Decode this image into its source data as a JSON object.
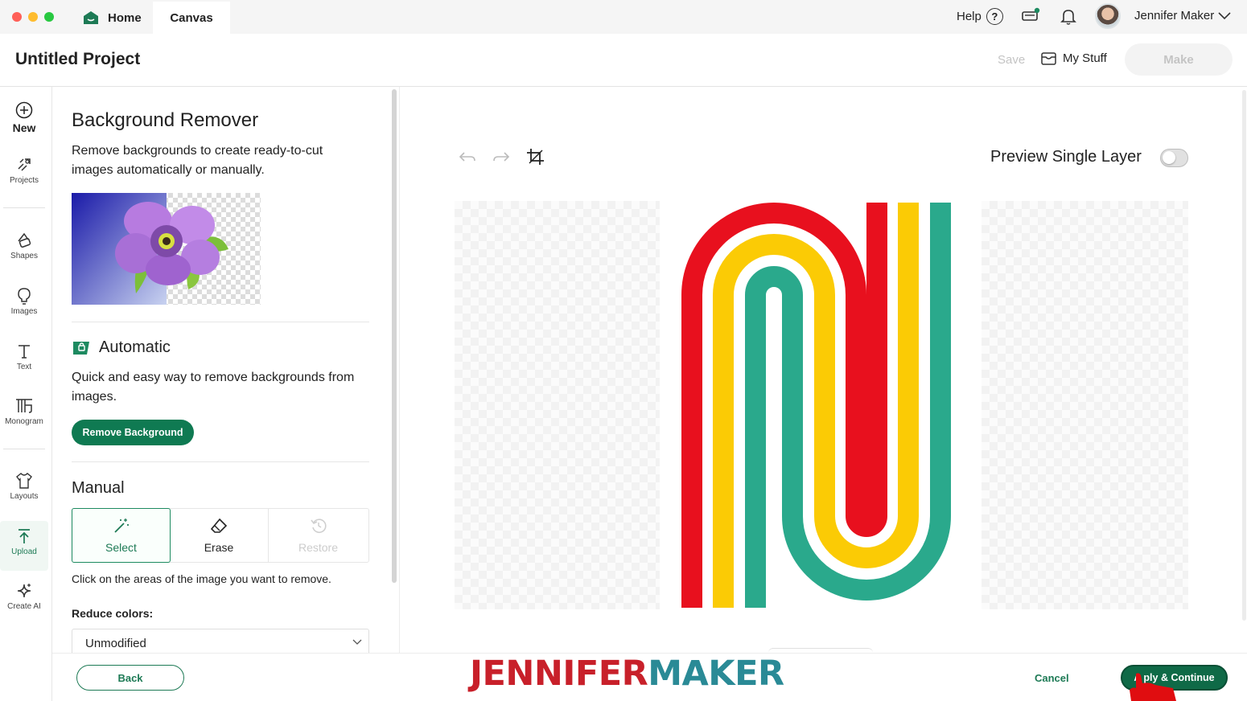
{
  "titlebar": {
    "tabs": [
      {
        "label": "Home"
      },
      {
        "label": "Canvas"
      }
    ],
    "help_label": "Help",
    "user_name": "Jennifer Maker"
  },
  "project": {
    "title": "Untitled Project",
    "save_label": "Save",
    "mystuff_label": "My Stuff",
    "make_label": "Make"
  },
  "leftnav": {
    "items": [
      {
        "label": "New",
        "icon": "plus-circle-icon"
      },
      {
        "label": "Projects",
        "icon": "projects-icon"
      },
      {
        "label": "Shapes",
        "icon": "shapes-icon"
      },
      {
        "label": "Images",
        "icon": "lightbulb-icon"
      },
      {
        "label": "Text",
        "icon": "text-icon"
      },
      {
        "label": "Monogram",
        "icon": "monogram-icon"
      },
      {
        "label": "Layouts",
        "icon": "shirt-icon"
      },
      {
        "label": "Upload",
        "icon": "upload-icon"
      },
      {
        "label": "Create AI",
        "icon": "sparkle-icon"
      }
    ]
  },
  "panel": {
    "title": "Background Remover",
    "description": "Remove backgrounds to create ready-to-cut images automatically or manually.",
    "automatic": {
      "title": "Automatic",
      "description": "Quick and easy way to remove backgrounds from images.",
      "button": "Remove Background"
    },
    "manual": {
      "title": "Manual",
      "modes": [
        {
          "label": "Select",
          "icon": "magic-wand-icon",
          "state": "selected"
        },
        {
          "label": "Erase",
          "icon": "eraser-icon",
          "state": "enabled"
        },
        {
          "label": "Restore",
          "icon": "restore-icon",
          "state": "disabled"
        }
      ],
      "hint": "Click on the areas of the image you want to remove.",
      "reduce_colors_label": "Reduce colors:",
      "reduce_colors_value": "Unmodified"
    }
  },
  "canvas": {
    "preview_label": "Preview Single Layer",
    "preview_toggle_on": false,
    "art_colors": [
      "#e8101e",
      "#fbcb05",
      "#2aa98c"
    ]
  },
  "footer": {
    "back_label": "Back",
    "brand_part1": "JENNIFER",
    "brand_part2": "MAKER",
    "cancel_label": "Cancel",
    "apply_label": "Apply & Continue",
    "apply_visible_label": "A  ply & Continue"
  }
}
